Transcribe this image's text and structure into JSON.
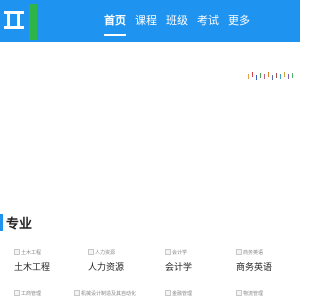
{
  "nav": {
    "items": [
      {
        "label": "首页",
        "active": true
      },
      {
        "label": "课程",
        "active": false
      },
      {
        "label": "班级",
        "active": false
      },
      {
        "label": "考试",
        "active": false
      },
      {
        "label": "更多",
        "active": false
      }
    ]
  },
  "section": {
    "title": "专业"
  },
  "majors": [
    {
      "thumb_alt": "土木工程",
      "name": "土木工程"
    },
    {
      "thumb_alt": "人力资源",
      "name": "人力资源"
    },
    {
      "thumb_alt": "会计学",
      "name": "会计学"
    },
    {
      "thumb_alt": "商务英语",
      "name": "商务英语"
    },
    {
      "thumb_alt": "工商管理",
      "name": ""
    },
    {
      "thumb_alt": "机械设计制造及其自动化",
      "name": ""
    },
    {
      "thumb_alt": "金融管理",
      "name": ""
    },
    {
      "thumb_alt": "物流管理",
      "name": ""
    }
  ],
  "colors": {
    "brand_blue": "#1f93f0",
    "logo_green": "#2fb44a",
    "nav_text": "#ffffff"
  }
}
